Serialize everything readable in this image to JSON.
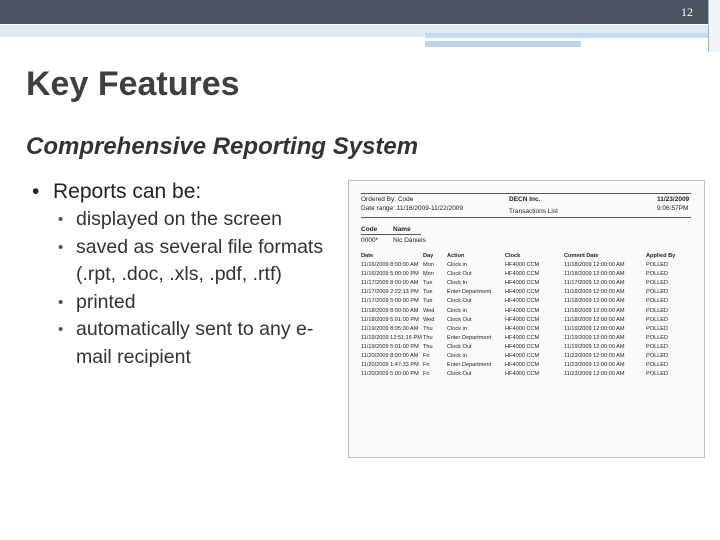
{
  "page_number": "12",
  "slide": {
    "title": "Key Features",
    "subtitle": "Comprehensive Reporting System",
    "bullet": "Reports can be:",
    "sub_bullets": [
      "displayed on the screen",
      "saved as several file formats (.rpt, .doc, .xls, .pdf, .rtf)",
      "printed",
      "automatically sent to any e-mail recipient"
    ]
  },
  "report": {
    "ordered_by": "Ordered By: Code",
    "date_range": "Date range: 11/16/2009-11/22/2009",
    "company": "DECN Inc.",
    "report_title": "Transactions List",
    "date": "11/23/2009",
    "time": "9:06:57PM",
    "employee_headers": [
      "Code",
      "Name"
    ],
    "employee": [
      "0000*",
      "Nic Daniels"
    ],
    "columns": [
      "Date",
      "Day",
      "Action",
      "Clock",
      "Commit Date",
      "Applied By"
    ],
    "rows": [
      [
        "11/16/2009 8:00:00 AM",
        "Mon",
        "Clock in",
        "HF4000 CCM",
        "11/18/2009 12:00:00 AM",
        "POLLED"
      ],
      [
        "11/16/2009 5:00:00 PM",
        "Mon",
        "Clock Out",
        "HF4000 CCM",
        "11/18/2009 12:00:00 AM",
        "POLLED"
      ],
      [
        "11/17/2009 8:00:00 AM",
        "Tue",
        "Clock In",
        "HF4000 CCM",
        "11/17/2009 12:00:00 AM",
        "POLLED"
      ],
      [
        "11/17/2009 2:22:13 PM",
        "Tue",
        "Enter Department",
        "HF4000 CCM",
        "11/18/2009 12:00:00 AM",
        "POLLED"
      ],
      [
        "11/17/2009 5:00:00 PM",
        "Tue",
        "Clock Out",
        "HF4000 CCM",
        "11/18/2009 12:00:00 AM",
        "POLLED"
      ],
      [
        "11/18/2009 8:00:00 AM",
        "Wed",
        "Clock in",
        "HF4000 CCM",
        "11/18/2009 12:00:00 AM",
        "POLLED"
      ],
      [
        "11/18/2009 5:01:00 PM",
        "Wed",
        "Clock Out",
        "HF4000 CCM",
        "11/18/2009 12:00:00 AM",
        "POLLED"
      ],
      [
        "11/19/2009 8:05:00 AM",
        "Thu",
        "Clock in",
        "HF4000 CCM",
        "11/19/2009 12:00:00 AM",
        "POLLED"
      ],
      [
        "11/19/2009 12:51:16 PM",
        "Thu",
        "Enter Department",
        "HF4000 CCM",
        "11/19/2009 12:00:00 AM",
        "POLLED"
      ],
      [
        "11/19/2009 5:01:00 PM",
        "Thu",
        "Clock Out",
        "HF4000 CCM",
        "11/19/2009 12:00:00 AM",
        "POLLED"
      ],
      [
        "11/20/2009 8:00:00 AM",
        "Fri",
        "Clock in",
        "HF4000 CCM",
        "11/23/2009 12:00:00 AM",
        "POLLED"
      ],
      [
        "11/20/2009 1:47:33 PM",
        "Fri",
        "Enter Department",
        "HF4000 CCM",
        "11/23/2009 12:00:00 AM",
        "POLLED"
      ],
      [
        "11/20/2009 5:00:00 PM",
        "Fri",
        "Clock Out",
        "HF4000 CCM",
        "11/23/2009 12:00:00 AM",
        "POLLED"
      ]
    ]
  }
}
